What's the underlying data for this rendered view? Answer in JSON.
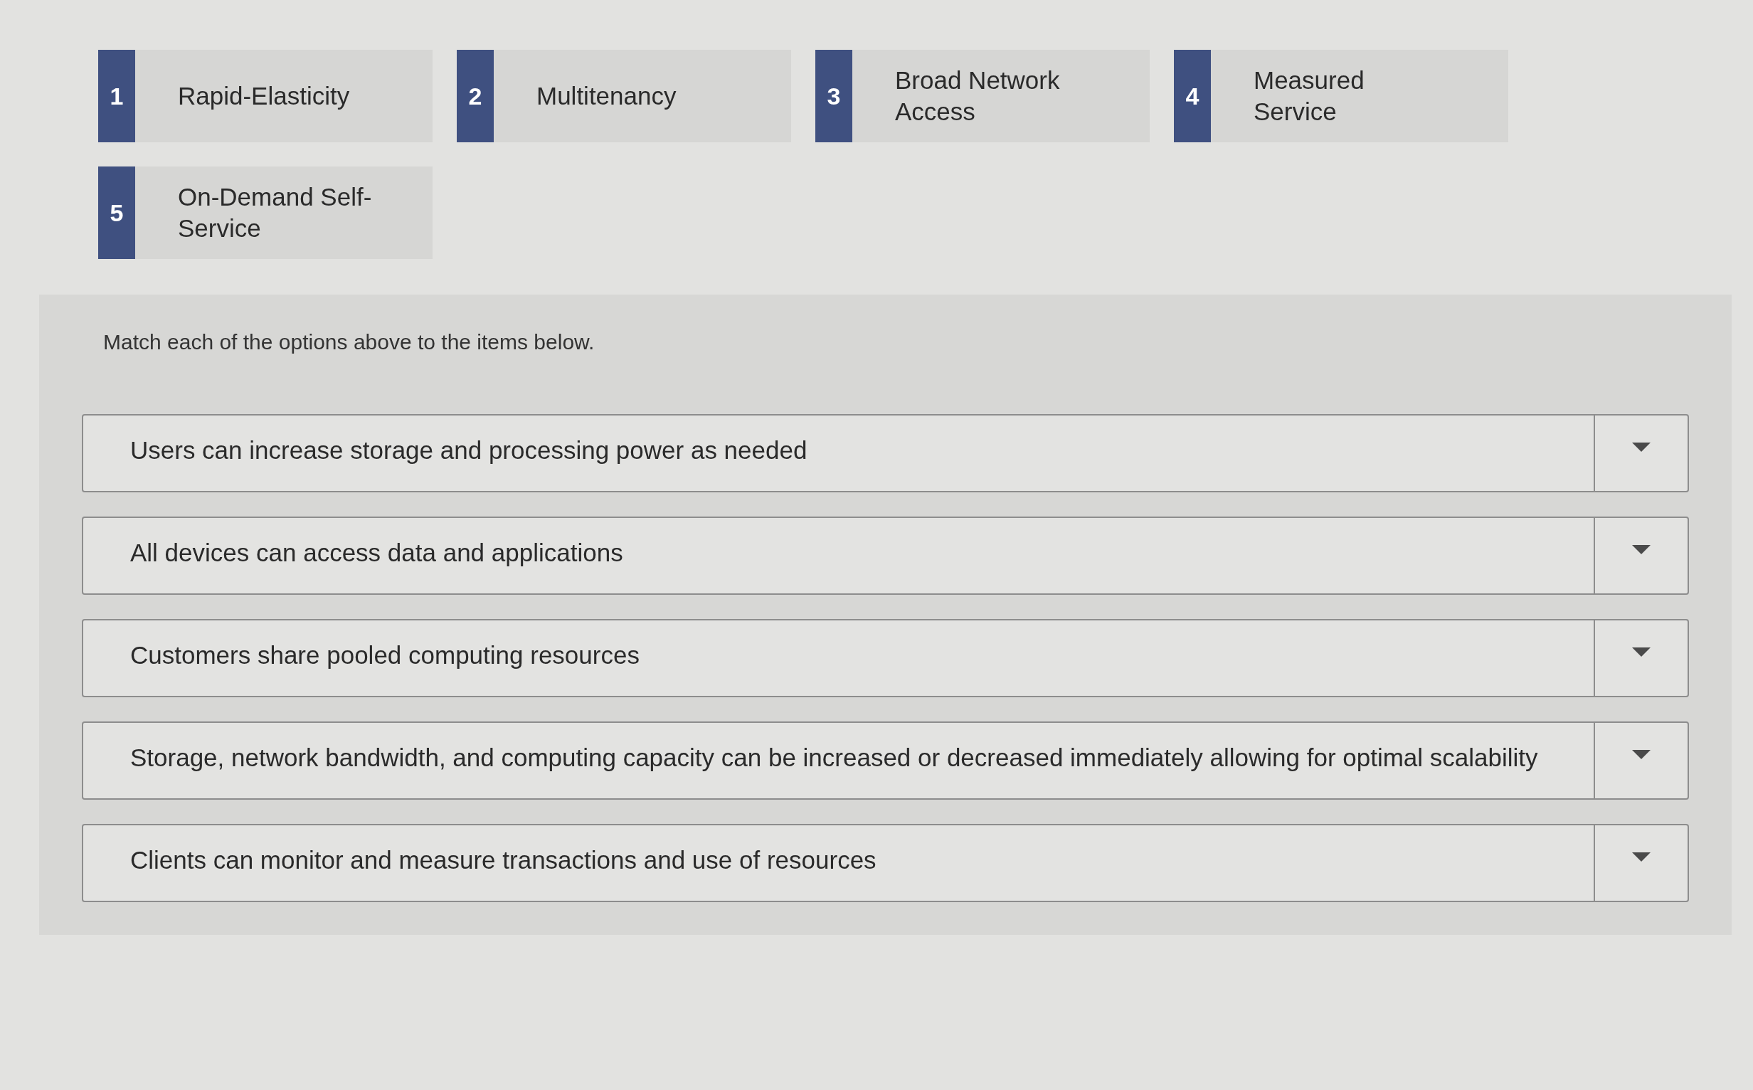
{
  "options": [
    {
      "number": "1",
      "label": "Rapid-Elasticity"
    },
    {
      "number": "2",
      "label": "Multitenancy"
    },
    {
      "number": "3",
      "label": "Broad Network Access"
    },
    {
      "number": "4",
      "label": "Measured Service"
    },
    {
      "number": "5",
      "label": "On-Demand Self-Service"
    }
  ],
  "instruction": "Match each of the options above to the items below.",
  "items": [
    {
      "text": "Users can increase storage and processing power as needed"
    },
    {
      "text": "All devices can access data and applications"
    },
    {
      "text": "Customers share pooled computing resources"
    },
    {
      "text": "Storage, network bandwidth, and computing capacity can be increased or decreased immediately allowing for optimal scalability"
    },
    {
      "text": "Clients can monitor and measure transactions and use of resources"
    }
  ]
}
